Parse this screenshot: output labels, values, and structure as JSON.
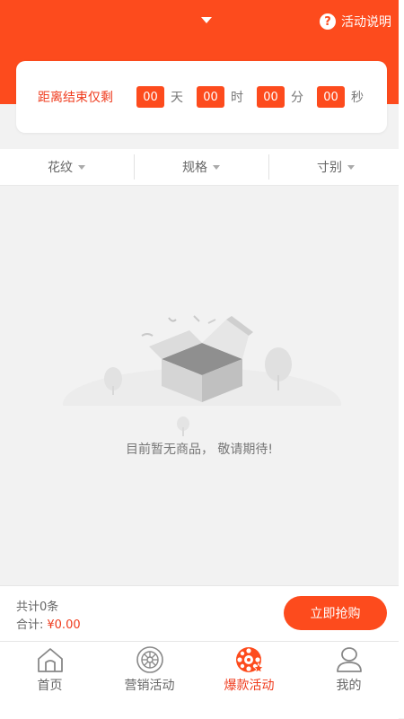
{
  "header": {
    "help_label": "活动说明",
    "help_icon": "question-icon"
  },
  "countdown": {
    "label": "距离结束仅剩",
    "days": "00",
    "days_unit": "天",
    "hours": "00",
    "hours_unit": "时",
    "minutes": "00",
    "minutes_unit": "分",
    "seconds": "00",
    "seconds_unit": "秒"
  },
  "filters": [
    {
      "label": "花纹"
    },
    {
      "label": "规格"
    },
    {
      "label": "寸别"
    }
  ],
  "empty": {
    "message": "目前暂无商品， 敬请期待!"
  },
  "summary": {
    "count_text": "共计0条",
    "total_label": "合计:",
    "total_value": "¥0.00",
    "buy_label": "立即抢购"
  },
  "tabs": [
    {
      "label": "首页",
      "icon": "home-icon"
    },
    {
      "label": "营销活动",
      "icon": "wheel-icon"
    },
    {
      "label": "爆款活动",
      "icon": "hot-deal-icon"
    },
    {
      "label": "我的",
      "icon": "user-icon"
    }
  ],
  "colors": {
    "accent": "#fd4b1d",
    "background": "#f2f2f2",
    "text_muted": "#666666"
  }
}
